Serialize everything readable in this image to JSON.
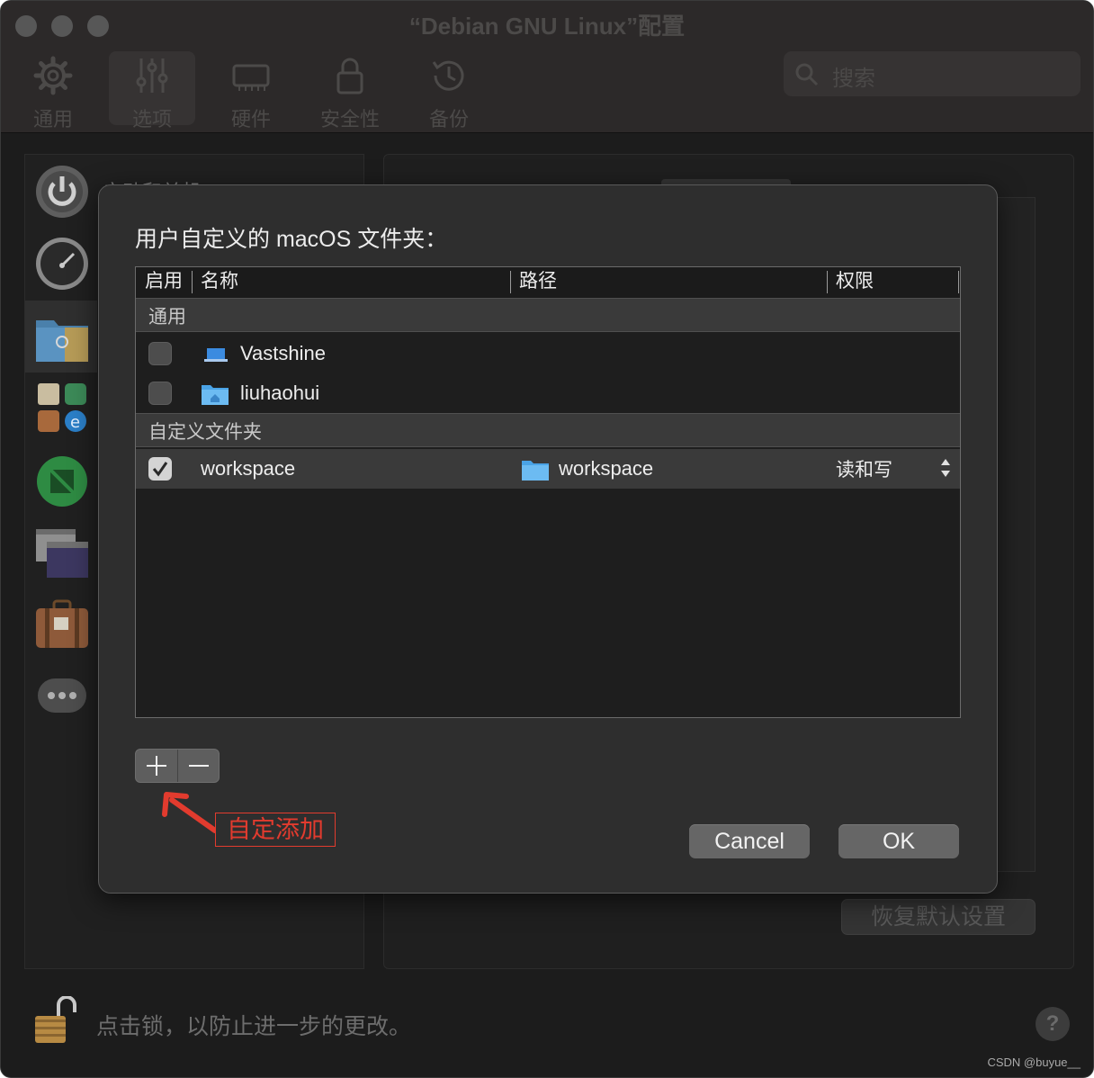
{
  "window": {
    "title": "“Debian GNU Linux”配置",
    "toolbar": [
      {
        "label": "通用",
        "icon": "gear-icon"
      },
      {
        "label": "选项",
        "icon": "sliders-icon",
        "active": true
      },
      {
        "label": "硬件",
        "icon": "chip-icon"
      },
      {
        "label": "安全性",
        "icon": "lock-icon"
      },
      {
        "label": "备份",
        "icon": "clock-history-icon"
      }
    ],
    "search_placeholder": "搜索"
  },
  "sidebar": {
    "peek_text": "启动和关机",
    "items": [
      "power-icon",
      "gauge-icon",
      "shared-folder-icon",
      "apps-icon",
      "green-app-icon",
      "windows-icon",
      "suitcase-icon",
      "more-icon"
    ]
  },
  "panel": {
    "restore_label": "恢复默认设置"
  },
  "sheet": {
    "title": "用户自定义的 macOS 文件夹：",
    "columns": {
      "enable": "启用",
      "name": "名称",
      "path": "路径",
      "permission": "权限"
    },
    "group_general": "通用",
    "general_rows": [
      {
        "name": "Vastshine",
        "checked": false,
        "icon": "laptop-icon"
      },
      {
        "name": "liuhaohui",
        "checked": false,
        "icon": "home-folder-icon"
      }
    ],
    "group_custom": "自定义文件夹",
    "custom_rows": [
      {
        "name": "workspace",
        "path": "workspace",
        "permission": "读和写",
        "checked": true
      }
    ],
    "add_symbol": "+",
    "remove_symbol": "−",
    "cancel_label": "Cancel",
    "ok_label": "OK"
  },
  "annotation": "自定添加",
  "footer": {
    "lock_text": "点击锁，以防止进一步的更改。",
    "help_symbol": "?",
    "watermark": "CSDN @buyue__"
  },
  "colors": {
    "annotation_red": "#e23b2e",
    "folder_blue": "#5ab3f0"
  }
}
